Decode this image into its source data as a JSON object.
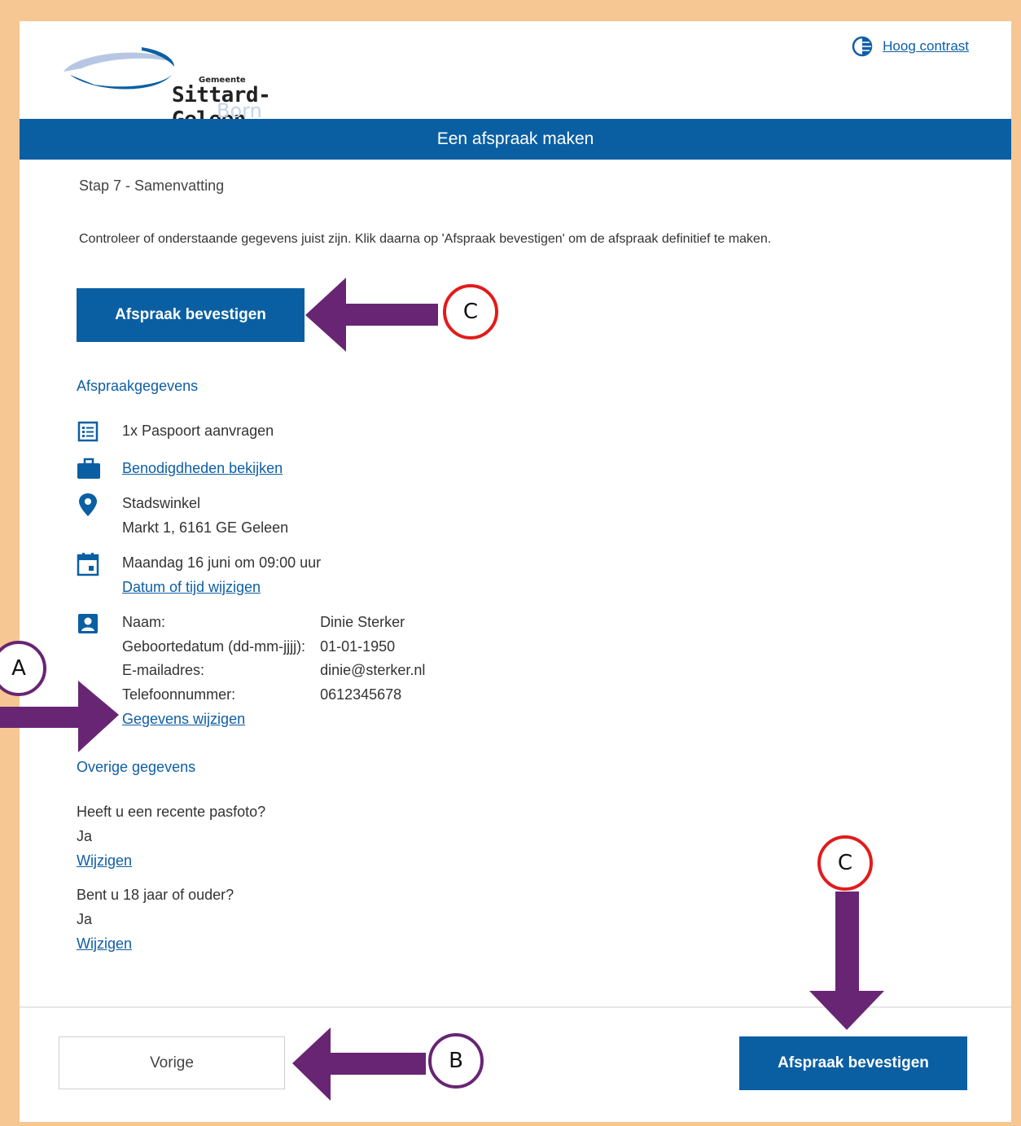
{
  "header": {
    "logo_small": "Gemeente",
    "logo_main": "Sittard-Geleen",
    "logo_sub": "Born",
    "contrast_icon": "contrast-icon",
    "contrast_label": "Hoog contrast"
  },
  "banner": {
    "title": "Een afspraak maken"
  },
  "step_label": "Stap 7 - Samenvatting",
  "intro_text": "Controleer of onderstaande gegevens juist zijn. Klik daarna op 'Afspraak bevestigen' om de afspraak definitief te maken.",
  "confirm_button_label": "Afspraak bevestigen",
  "appointment": {
    "section_title": "Afspraakgegevens",
    "product": "1x Paspoort aanvragen",
    "requirements_link": "Benodigdheden bekijken",
    "location_name": "Stadswinkel",
    "location_address": "Markt 1, 6161 GE Geleen",
    "datetime": "Maandag 16 juni om 09:00 uur",
    "change_datetime_link": "Datum of tijd wijzigen",
    "personal": [
      {
        "label": "Naam:",
        "value": "Dinie Sterker"
      },
      {
        "label": "Geboortedatum (dd-mm-jjjj):",
        "value": "01-01-1950"
      },
      {
        "label": "E-mailadres:",
        "value": "dinie@sterker.nl"
      },
      {
        "label": "Telefoonnummer:",
        "value": "0612345678"
      }
    ],
    "change_details_link": "Gegevens wijzigen",
    "icons": [
      "list-icon",
      "briefcase-icon",
      "location-pin-icon",
      "calendar-icon",
      "contact-card-icon"
    ]
  },
  "other": {
    "section_title": "Overige gegevens",
    "questions": [
      {
        "question": "Heeft u een recente pasfoto?",
        "answer": "Ja",
        "change_link": "Wijzigen"
      },
      {
        "question": "Bent u 18 jaar of ouder?",
        "answer": "Ja",
        "change_link": "Wijzigen"
      }
    ]
  },
  "footer": {
    "previous_label": "Vorige",
    "confirm_label": "Afspraak bevestigen"
  },
  "annotations": {
    "labels": [
      "A",
      "B",
      "C",
      "C"
    ],
    "arrow_color": "#682574",
    "circle_color_a_b": "#682574",
    "circle_color_c": "#e21b1b"
  },
  "colors": {
    "primary": "#0a5fa3",
    "link": "#0e5ea6",
    "frame": "#f6c792"
  }
}
